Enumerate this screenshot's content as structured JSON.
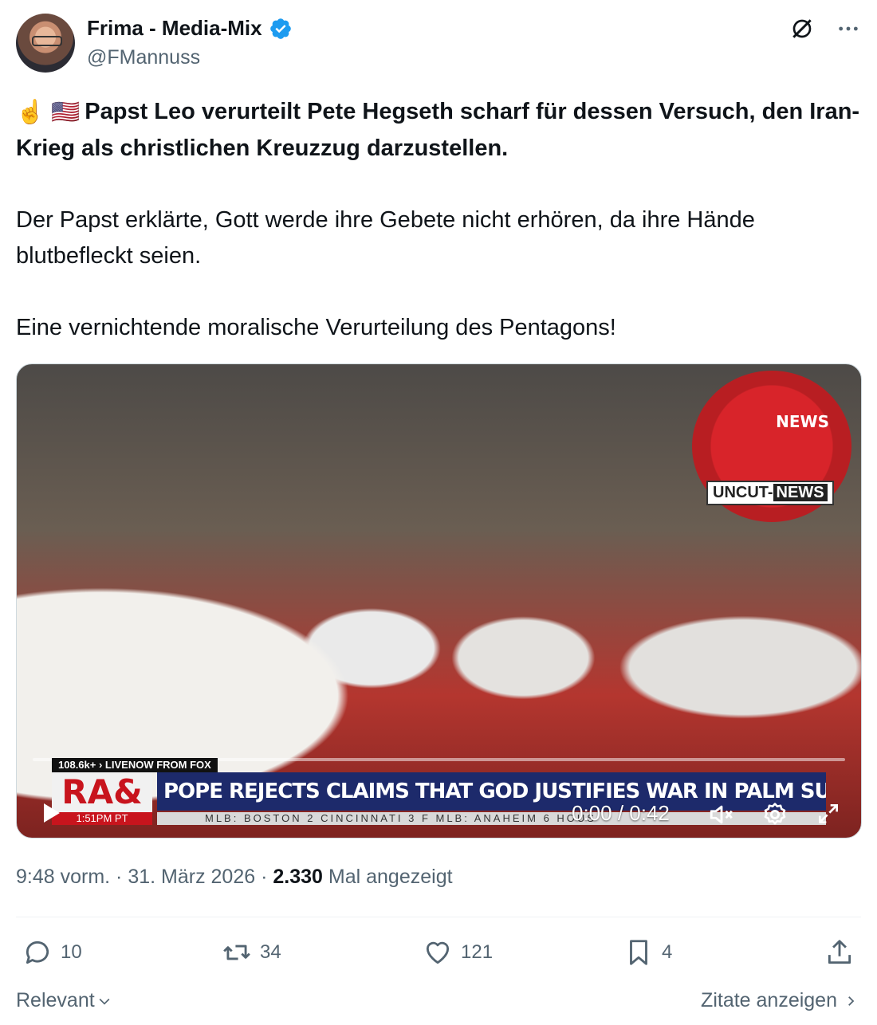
{
  "author": {
    "display_name": "Frima - Media-Mix",
    "handle": "@FMannuss",
    "verified": true
  },
  "icons": {
    "grok": "grok-icon",
    "more": "more-icon"
  },
  "post": {
    "line1_emoji": "☝️ 🇺🇸",
    "headline": "Papst Leo verurteilt Pete Hegseth scharf für dessen Versuch, den Iran-Krieg als christlichen Kreuzzug darzustellen.",
    "paragraph2": "Der Papst erklärte, Gott werde ihre Gebete nicht erhören, da ihre Hände blutbefleckt seien.",
    "paragraph3": "Eine vernichtende moralische Verurteilung des Pentagons!"
  },
  "video": {
    "logo_news": "NEWS",
    "logo_uncut": "UNCUT-",
    "logo_uncut_news": "NEWS",
    "tv_views": "108.6k+",
    "tv_source": "LIVENOW FROM FOX",
    "tv_badge": "RA&",
    "tv_headline": "POPE REJECTS CLAIMS THAT GOD JUSTIFIES WAR IN PALM SUNDAY MASS MESSAGE",
    "tv_time": "1:51PM PT",
    "tv_scores": "MLB: BOSTON 2 CINCINNATI 3 F   MLB: ANAHEIM 6 HOUS",
    "time_display": "0:00 / 0:42",
    "progress": 0
  },
  "meta": {
    "time": "9:48 vorm.",
    "date": "31. März 2026",
    "views": "2.330",
    "views_label": "Mal angezeigt"
  },
  "actions": {
    "replies": "10",
    "reposts": "34",
    "likes": "121",
    "bookmarks": "4"
  },
  "footer": {
    "sort_label": "Relevant",
    "quotes_label": "Zitate anzeigen"
  },
  "colors": {
    "verified": "#1d9bf0",
    "secondary_text": "#536471",
    "text": "#0f1419"
  }
}
